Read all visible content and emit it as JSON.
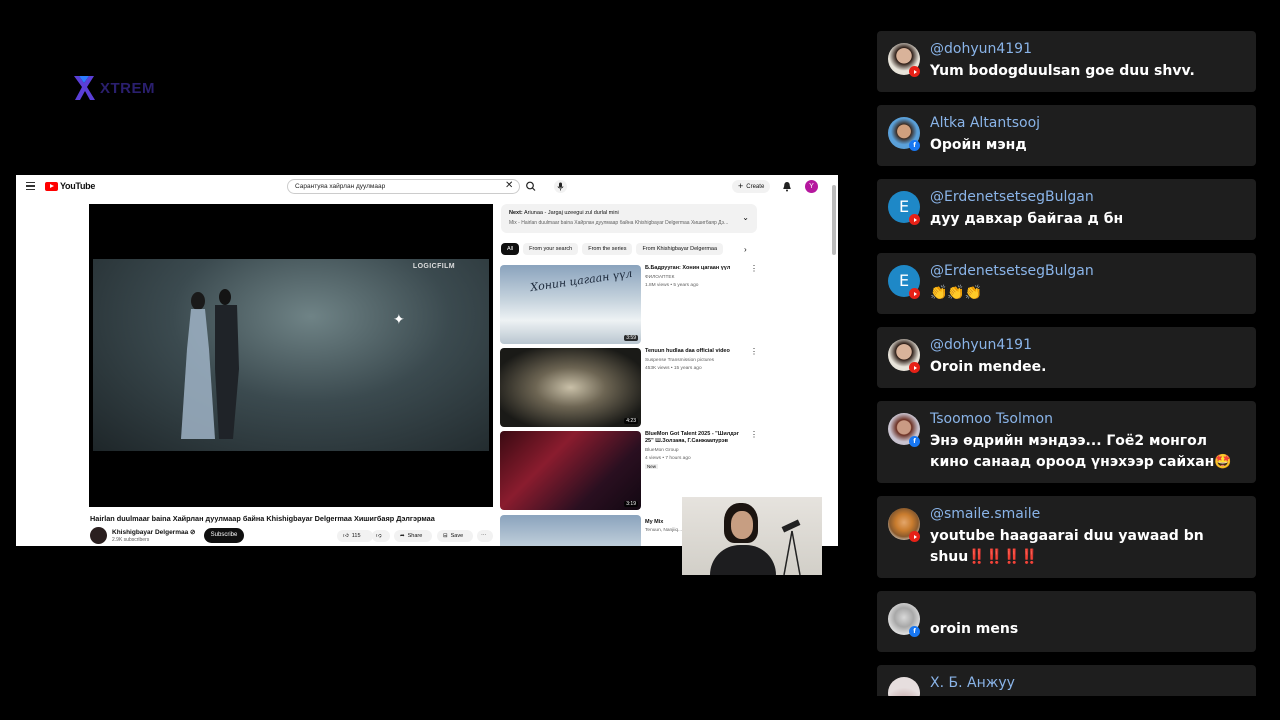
{
  "stream": {
    "logo_text": "XTREM"
  },
  "youtube": {
    "logo_text": "YouTube",
    "search_query": "Сарантуяа хайрлан дуулмаар",
    "create_label": "Create",
    "avatar_letter": "Y",
    "player_watermark": "LOGICFILM",
    "video_title": "Hairlan duulmaar baina Хайрлан дуулмаар байна Khishigbayar Delgermaa Хишигбаяр Дэлгэрмаа",
    "channel_name": "Khishigbayar Delgermaa",
    "channel_verified": "⊘",
    "channel_subs": "2.9K subscribers",
    "subscribe_label": "Subscribe",
    "like_count": "115",
    "share_label": "Share",
    "save_label": "Save",
    "next": {
      "prefix": "Next:",
      "title": "Ariunaa - Jargaj uzeegui zul durlal mini",
      "subtitle": "Mix - Hairlan duulmaar baina Хайрлан дуулмаар байна Khishigbayar Delgermaa Хишигбаяр Дэ..."
    },
    "chips": [
      "All",
      "From your search",
      "From the series",
      "From Khishigbayar Delgermaa"
    ],
    "recommendations": [
      {
        "title": "Б.Бадрууган: Хонин цагаан үүл",
        "channel": "ФИЛОАПТЕК",
        "meta": "1.8M views • 5 years ago",
        "duration": "3:59",
        "thumb_text": "Хонин цагаан үүл"
      },
      {
        "title": "Tenuun hudlaa daa official video",
        "channel": "Suspense Transmission pictures",
        "meta": "453K views • 15 years ago",
        "duration": "4:23"
      },
      {
        "title": "BlueMon Got Talent 2025 - \"Шилдэг 25\" Ш.Золзаяа, Г.Санжаапурэв",
        "channel": "BlueMon Group",
        "meta": "4 views • 7 hours ago",
        "badge": "New",
        "duration": "3:19"
      },
      {
        "title": "My Mix",
        "channel": "Tenuun, Nanjiiq..."
      }
    ]
  },
  "chat": {
    "messages": [
      {
        "name": "@dohyun4191",
        "text": "Yum bodogduulsan goe duu shvv."
      },
      {
        "name": "Altka Altantsooj",
        "text": "Оройн мэнд"
      },
      {
        "name": "@ErdenetsetsegBulgan",
        "avatar_letter": "E",
        "text": "дуу давхар байгаа д бн"
      },
      {
        "name": "@ErdenetsetsegBulgan",
        "avatar_letter": "E",
        "text": "👏👏👏"
      },
      {
        "name": "@dohyun4191",
        "text": "Oroin mendee."
      },
      {
        "name": "Tsoomoo Tsolmon",
        "text": "Энэ өдрийн мэндээ... Гоё2 монгол кино санаад ороод үнэхээр сайхан🤩"
      },
      {
        "name": "@smaile.smaile",
        "text": "youtube haagaarai duu yawaad bn shuu‼️‼️‼️‼️"
      },
      {
        "name": "",
        "text": "oroin mens"
      },
      {
        "name": "Х. Б. Анжуу",
        "text": ""
      }
    ]
  }
}
